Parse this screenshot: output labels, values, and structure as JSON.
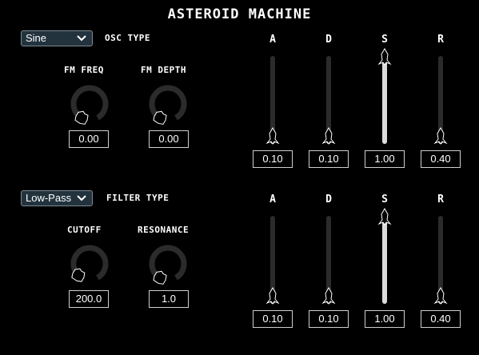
{
  "title": "ASTEROID MACHINE",
  "osc": {
    "type_value": "Sine",
    "type_label": "OSC TYPE",
    "knobs": [
      {
        "label": "FM FREQ",
        "value": "0.00",
        "level": 0
      },
      {
        "label": "FM DEPTH",
        "value": "0.00",
        "level": 0
      }
    ],
    "envelope": [
      {
        "label": "A",
        "value": "0.10",
        "level": 0.1
      },
      {
        "label": "D",
        "value": "0.10",
        "level": 0.1
      },
      {
        "label": "S",
        "value": "1.00",
        "level": 1.0
      },
      {
        "label": "R",
        "value": "0.40",
        "level": 0.1
      }
    ]
  },
  "filter": {
    "type_value": "Low-Pass",
    "type_label": "FILTER TYPE",
    "knobs": [
      {
        "label": "CUTOFF",
        "value": "200.0",
        "level": 0.05
      },
      {
        "label": "RESONANCE",
        "value": "1.0",
        "level": 0
      }
    ],
    "envelope": [
      {
        "label": "A",
        "value": "0.10",
        "level": 0.1
      },
      {
        "label": "D",
        "value": "0.10",
        "level": 0.1
      },
      {
        "label": "S",
        "value": "1.00",
        "level": 1.0
      },
      {
        "label": "R",
        "value": "0.40",
        "level": 0.1
      }
    ]
  },
  "icons": {
    "dropdown": "chevron-down-icon",
    "knob_handle": "asteroid-icon",
    "slider_handle": "rocket-icon"
  },
  "colors": {
    "background": "#000000",
    "dropdown_bg": "#22333d",
    "track": "#2b2b2b",
    "fill": "#dcdcdc"
  }
}
